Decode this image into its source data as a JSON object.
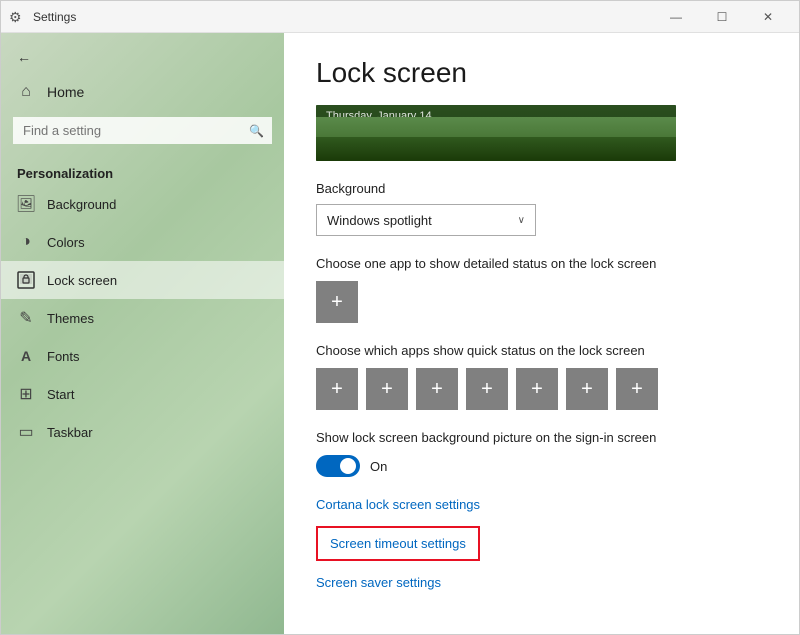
{
  "window": {
    "title": "Settings",
    "controls": {
      "minimize": "—",
      "maximize": "☐",
      "close": "✕"
    }
  },
  "sidebar": {
    "back_arrow": "←",
    "home_label": "Home",
    "search_placeholder": "Find a setting",
    "section_label": "Personalization",
    "items": [
      {
        "id": "background",
        "label": "Background",
        "icon": "🖼"
      },
      {
        "id": "colors",
        "label": "Colors",
        "icon": "🎨"
      },
      {
        "id": "lock-screen",
        "label": "Lock screen",
        "icon": "🔒"
      },
      {
        "id": "themes",
        "label": "Themes",
        "icon": "✏"
      },
      {
        "id": "fonts",
        "label": "Fonts",
        "icon": "A"
      },
      {
        "id": "start",
        "label": "Start",
        "icon": "⊞"
      },
      {
        "id": "taskbar",
        "label": "Taskbar",
        "icon": "▬"
      }
    ]
  },
  "main": {
    "page_title": "Lock screen",
    "preview_time": "Thursday, January 14",
    "background_label": "Background",
    "background_value": "Windows spotlight",
    "dropdown_arrow": "∨",
    "detailed_status_label": "Choose one app to show detailed status on the lock screen",
    "quick_status_label": "Choose which apps show quick status on the lock screen",
    "quick_status_count": 7,
    "signin_toggle_label": "Show lock screen background picture on the sign-in screen",
    "toggle_state": "On",
    "link_cortana": "Cortana lock screen settings",
    "link_screen_timeout": "Screen timeout settings",
    "link_screen_saver": "Screen saver settings"
  },
  "icons": {
    "back": "←",
    "home": "⌂",
    "search": "⚲",
    "background_icon": "🖼",
    "colors_icon": "◑",
    "lockscreen_icon": "⬜",
    "themes_icon": "✎",
    "fonts_icon": "A",
    "start_icon": "⊞",
    "taskbar_icon": "▭"
  }
}
